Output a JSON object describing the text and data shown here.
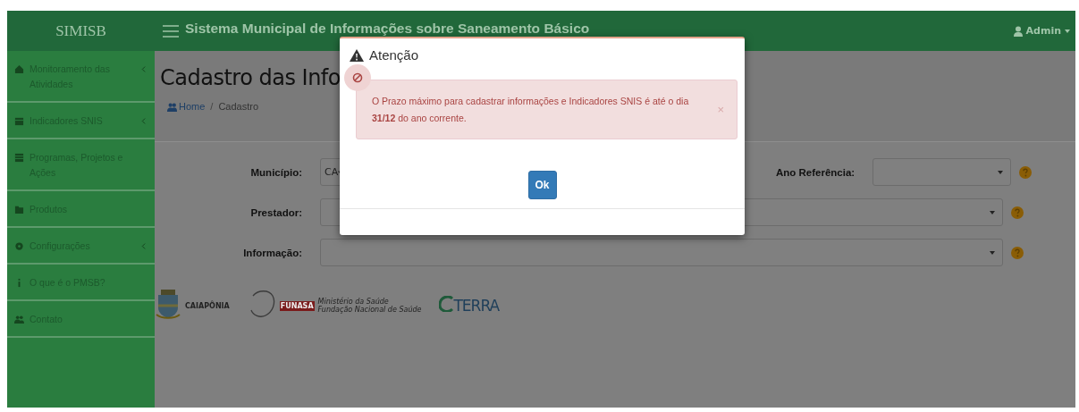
{
  "header": {
    "brand": "SIMISB",
    "title": "Sistema Municipal de Informações sobre Saneamento Básico",
    "user": "Admin"
  },
  "sidebar": {
    "items": [
      {
        "label": "Monitoramento das Atividades",
        "submenu": true
      },
      {
        "label": "Indicadores SNIS",
        "submenu": true
      },
      {
        "label": "Programas, Projetos e Ações",
        "submenu": false
      },
      {
        "label": "Produtos",
        "submenu": false
      },
      {
        "label": "Configurações",
        "submenu": true
      },
      {
        "label": "O que é o PMSB?",
        "submenu": false
      },
      {
        "label": "Contato",
        "submenu": false
      }
    ]
  },
  "page": {
    "title": "Cadastro das Info",
    "breadcrumb": [
      "Home",
      "Cadastro"
    ],
    "breadcrumb_separator": "/"
  },
  "form": {
    "fields": [
      {
        "label": "Município:",
        "value": "CA"
      },
      {
        "label": "Ano Referência:"
      },
      {
        "label": "Prestador:"
      },
      {
        "label": "Informação:"
      }
    ]
  },
  "logos": {
    "caiaponia": "CAIAPÔNIA",
    "funasa": "FUNASA",
    "ministry": [
      "Ministério da Saúde",
      "Fundação Nacional de Saúde"
    ],
    "terra": "TERRA"
  },
  "modal": {
    "title": "Atenção",
    "alert": "O Prazo máximo para cadastrar informações e Indicadores SNIS é até o dia **31/12** do ano corrente.",
    "close": "×",
    "button": "Ok"
  }
}
